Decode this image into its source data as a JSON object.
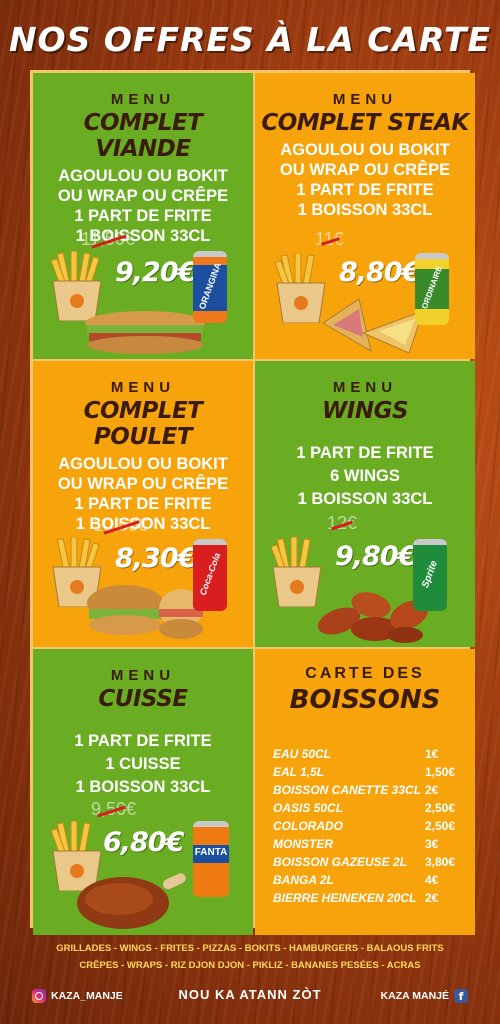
{
  "header": {
    "title": "NOS OFFRES À LA CARTE"
  },
  "menus": [
    {
      "word": "MENU",
      "name": "COMPLET VIANDE",
      "lines": [
        "AGOULOU OU BOKIT",
        "OU WRAP OU CRÊPE",
        "1 PART DE FRITE",
        "1 BOISSON 33CL"
      ],
      "old_price": "11,50€",
      "new_price": "9,20€",
      "drink_brand": "ORANGINA",
      "color": "#6aad23"
    },
    {
      "word": "MENU",
      "name": "COMPLET STEAK",
      "lines": [
        "AGOULOU OU BOKIT",
        "OU WRAP OU CRÊPE",
        "1 PART DE FRITE",
        "1 BOISSON 33CL"
      ],
      "old_price": "11€",
      "new_price": "8,80€",
      "drink_brand": "ORDINAIRE",
      "color": "#f6a30c"
    },
    {
      "word": "MENU",
      "name": "COMPLET POULET",
      "lines": [
        "AGOULOU OU BOKIT",
        "OU WRAP OU CRÊPE",
        "1 PART DE FRITE",
        "1 BOISSON 33CL"
      ],
      "old_price": "10,50€",
      "new_price": "8,30€",
      "drink_brand": "Coca-Cola",
      "color": "#f6a30c"
    },
    {
      "word": "MENU",
      "name": "WINGS",
      "lines": [
        "1 PART DE FRITE",
        "6 WINGS",
        "1 BOISSON 33CL"
      ],
      "old_price": "12€",
      "new_price": "9,80€",
      "drink_brand": "Sprite",
      "color": "#6aad23"
    },
    {
      "word": "MENU",
      "name": "CUISSE",
      "lines": [
        "1 PART DE FRITE",
        "1 CUISSE",
        "1 BOISSON 33CL"
      ],
      "old_price": "9,50€",
      "new_price": "6,80€",
      "drink_brand": "FANTA",
      "color": "#6aad23"
    }
  ],
  "drinks": {
    "word": "CARTE DES",
    "name": "BOISSONS",
    "items": [
      {
        "name": "EAU 50CL",
        "price": "1€"
      },
      {
        "name": "EAL 1,5L",
        "price": "1,50€"
      },
      {
        "name": "BOISSON CANETTE 33CL",
        "price": "2€"
      },
      {
        "name": "OASIS 50CL",
        "price": "2,50€"
      },
      {
        "name": "COLORADO",
        "price": "2,50€"
      },
      {
        "name": "MONSTER",
        "price": "3€"
      },
      {
        "name": "BOISSON GAZEUSE 2L",
        "price": "3,80€"
      },
      {
        "name": "BANGA 2L",
        "price": "4€"
      },
      {
        "name": "BIERRE HEINEKEN 20CL",
        "price": "2€"
      }
    ]
  },
  "tagline": {
    "line1": "GRILLADES - WINGS - FRITES - PIZZAS - BOKITS - HAMBURGERS - BALAOUS FRITS",
    "line2": "CRÊPES - WRAPS - RIZ DJON DJON - PIKLIZ - BANANES PESÉES - ACRAS"
  },
  "footer": {
    "instagram": "KAZA_MANJE",
    "slogan": "NOU KA ATANN ZÒT",
    "facebook": "KAZA MANJÉ",
    "fb_letter": "f"
  },
  "colors": {
    "green": "#6aad23",
    "orange": "#f6a30c",
    "dark_brown": "#3b1c0b",
    "wood": "#9c3a10"
  },
  "icons": [
    "instagram-icon",
    "facebook-icon"
  ]
}
